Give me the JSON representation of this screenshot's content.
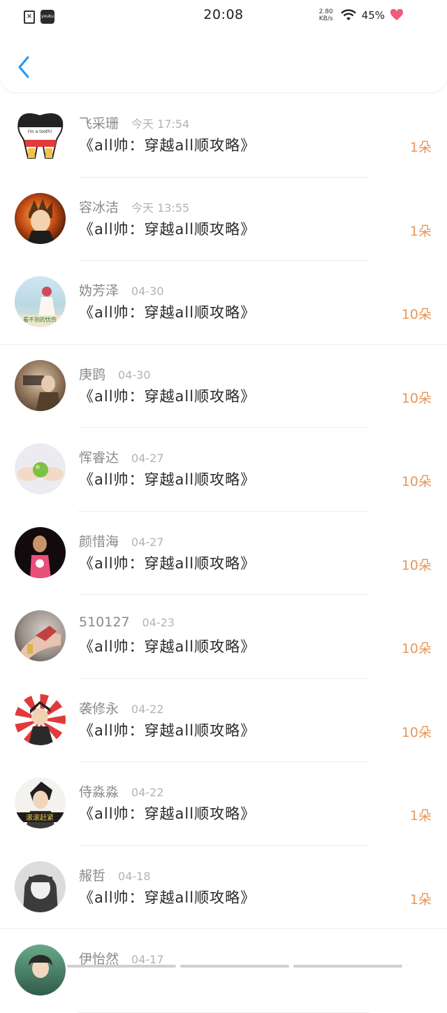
{
  "statusbar": {
    "time": "20:08",
    "net_speed_value": "2.80",
    "net_speed_unit": "KB/s",
    "battery": "45%",
    "app_badge": "youku"
  },
  "header": {
    "back_icon": "chevron-left-icon"
  },
  "accent_color": "#e8965a",
  "back_color": "#2196f3",
  "items": [
    {
      "name": "飞采珊",
      "time": "今天 17:54",
      "title": "《all帅：穿越all顺攻略》",
      "gift": "1朵"
    },
    {
      "name": "容冰洁",
      "time": "今天 13:55",
      "title": "《all帅：穿越all顺攻略》",
      "gift": "1朵"
    },
    {
      "name": "妫芳泽",
      "time": "04-30",
      "title": "《all帅：穿越all顺攻略》",
      "gift": "10朵"
    },
    {
      "name": "庚鹍",
      "time": "04-30",
      "title": "《all帅：穿越all顺攻略》",
      "gift": "10朵"
    },
    {
      "name": "恽睿达",
      "time": "04-27",
      "title": "《all帅：穿越all顺攻略》",
      "gift": "10朵"
    },
    {
      "name": "颜惜海",
      "time": "04-27",
      "title": "《all帅：穿越all顺攻略》",
      "gift": "10朵"
    },
    {
      "name": "510127",
      "time": "04-23",
      "title": "《all帅：穿越all顺攻略》",
      "gift": "10朵"
    },
    {
      "name": "袭修永",
      "time": "04-22",
      "title": "《all帅：穿越all顺攻略》",
      "gift": "10朵"
    },
    {
      "name": "侍淼淼",
      "time": "04-22",
      "title": "《all帅：穿越all顺攻略》",
      "gift": "1朵"
    },
    {
      "name": "赧哲",
      "time": "04-18",
      "title": "《all帅：穿越all顺攻略》",
      "gift": "1朵"
    },
    {
      "name": "伊怡然",
      "time": "04-17",
      "title": "",
      "gift": ""
    }
  ],
  "avatar_text": {
    "a0": "I'm a tooth!",
    "a2": "看不到的忧伤",
    "a8": "滚滚赶紧"
  }
}
